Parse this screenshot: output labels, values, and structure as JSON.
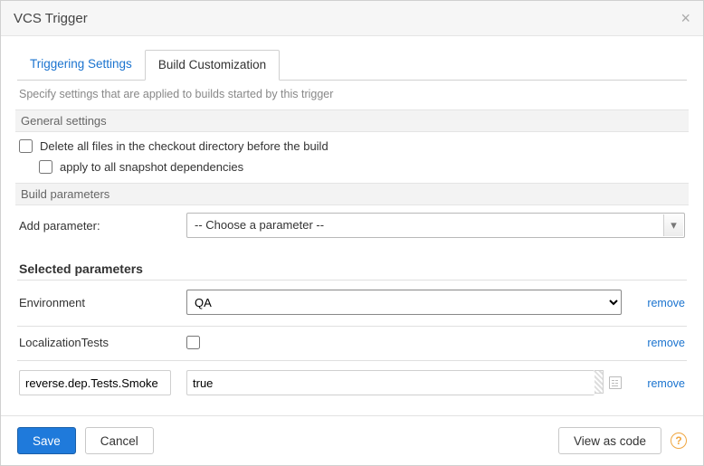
{
  "dialog": {
    "title": "VCS Trigger",
    "hint": "Specify settings that are applied to builds started by this trigger"
  },
  "tabs": {
    "triggering": "Triggering Settings",
    "customization": "Build Customization"
  },
  "sections": {
    "general": "General settings",
    "build_params": "Build parameters"
  },
  "general": {
    "delete_files_label": "Delete all files in the checkout directory before the build",
    "apply_snapshot_label": "apply to all snapshot dependencies"
  },
  "add_param": {
    "label": "Add parameter:",
    "placeholder": "-- Choose a parameter --"
  },
  "selected_header": "Selected parameters",
  "params": [
    {
      "name": "Environment",
      "type": "select",
      "value": "QA"
    },
    {
      "name": "LocalizationTests",
      "type": "checkbox",
      "value": false
    },
    {
      "name": "reverse.dep.Tests.Smoke",
      "type": "text",
      "value": "true",
      "name_editable": true
    }
  ],
  "links": {
    "remove": "remove"
  },
  "footer": {
    "save": "Save",
    "cancel": "Cancel",
    "view_as_code": "View as code"
  }
}
